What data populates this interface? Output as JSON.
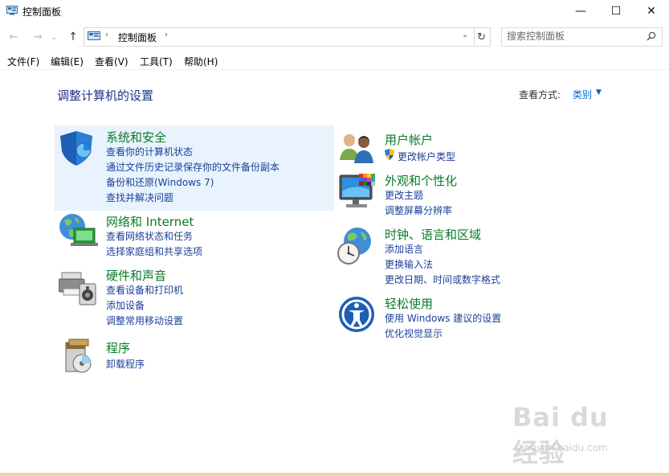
{
  "window": {
    "title": "控制面板",
    "minimize_glyph": "—",
    "maximize_glyph": "☐",
    "close_glyph": "✕"
  },
  "nav": {
    "back_glyph": "←",
    "forward_glyph": "→",
    "recent_glyph": "⌄",
    "up_glyph": "↑",
    "breadcrumb": "控制面板",
    "separator": "›",
    "dropdown_glyph": "⌄",
    "refresh_glyph": "↻",
    "search_placeholder": "搜索控制面板"
  },
  "menu": {
    "items": [
      "文件(F)",
      "编辑(E)",
      "查看(V)",
      "工具(T)",
      "帮助(H)"
    ]
  },
  "main": {
    "heading": "调整计算机的设置",
    "view_by_label": "查看方式:",
    "view_by_value": "类别",
    "view_by_caret": "▼"
  },
  "categories": {
    "system": {
      "title": "系统和安全",
      "links": [
        "查看你的计算机状态",
        "通过文件历史记录保存你的文件备份副本",
        "备份和还原(Windows 7)",
        "查找并解决问题"
      ],
      "icon": "shield-icon"
    },
    "network": {
      "title": "网络和 Internet",
      "links": [
        "查看网络状态和任务",
        "选择家庭组和共享选项"
      ],
      "icon": "globe-network-icon"
    },
    "hardware": {
      "title": "硬件和声音",
      "links": [
        "查看设备和打印机",
        "添加设备",
        "调整常用移动设置"
      ],
      "icon": "printer-icon"
    },
    "programs": {
      "title": "程序",
      "links": [
        "卸载程序"
      ],
      "icon": "programs-icon"
    },
    "users": {
      "title": "用户帐户",
      "links": [
        "更改帐户类型"
      ],
      "icon": "users-icon"
    },
    "appearance": {
      "title": "外观和个性化",
      "links": [
        "更改主题",
        "调整屏幕分辨率"
      ],
      "icon": "monitor-icon"
    },
    "clock": {
      "title": "时钟、语言和区域",
      "links": [
        "添加语言",
        "更换输入法",
        "更改日期、时间或数字格式"
      ],
      "icon": "clock-globe-icon"
    },
    "ease": {
      "title": "轻松使用",
      "links": [
        "使用 Windows 建议的设置",
        "优化视觉显示"
      ],
      "icon": "ease-of-access-icon"
    }
  },
  "watermark": {
    "main": "Bai du 经验",
    "sub": "jingyan.baidu.com"
  },
  "colors": {
    "link": "#1a3f99",
    "category_title": "#0a7a2a",
    "heading": "#1e3287",
    "highlight": "#e8f3fd"
  }
}
